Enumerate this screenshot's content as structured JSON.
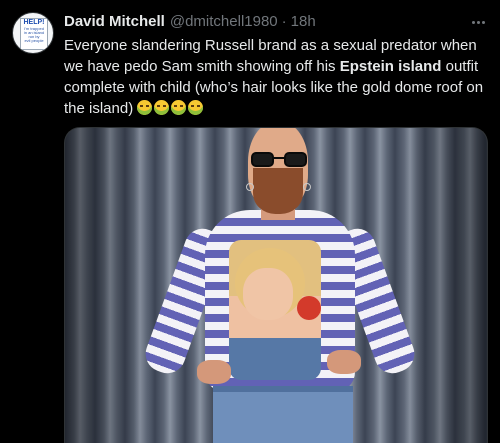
{
  "author": {
    "name": "David Mitchell",
    "handle": "@dmitchell1980",
    "separator": "·",
    "time": "18h",
    "avatar_sign": {
      "heading": "HELP!",
      "lines": [
        "I'm trapped",
        "in an island",
        "run by",
        "evil people"
      ]
    }
  },
  "tweet": {
    "text_part1": "Everyone slandering Russell brand as a sexual predator when we have pedo Sam smith showing off his ",
    "bold1": "Epstein",
    "space": " ",
    "bold2": "island",
    "text_part2": " outfit complete with child (who’s hair looks like the gold dome roof on the island) ",
    "emoji_name": "nauseated-face",
    "emoji_count": 4
  },
  "icons": {
    "more": "more-options-icon"
  },
  "colors": {
    "background": "#000000",
    "text": "#e7e9ea",
    "muted": "#71767b",
    "border": "#2f3336"
  }
}
